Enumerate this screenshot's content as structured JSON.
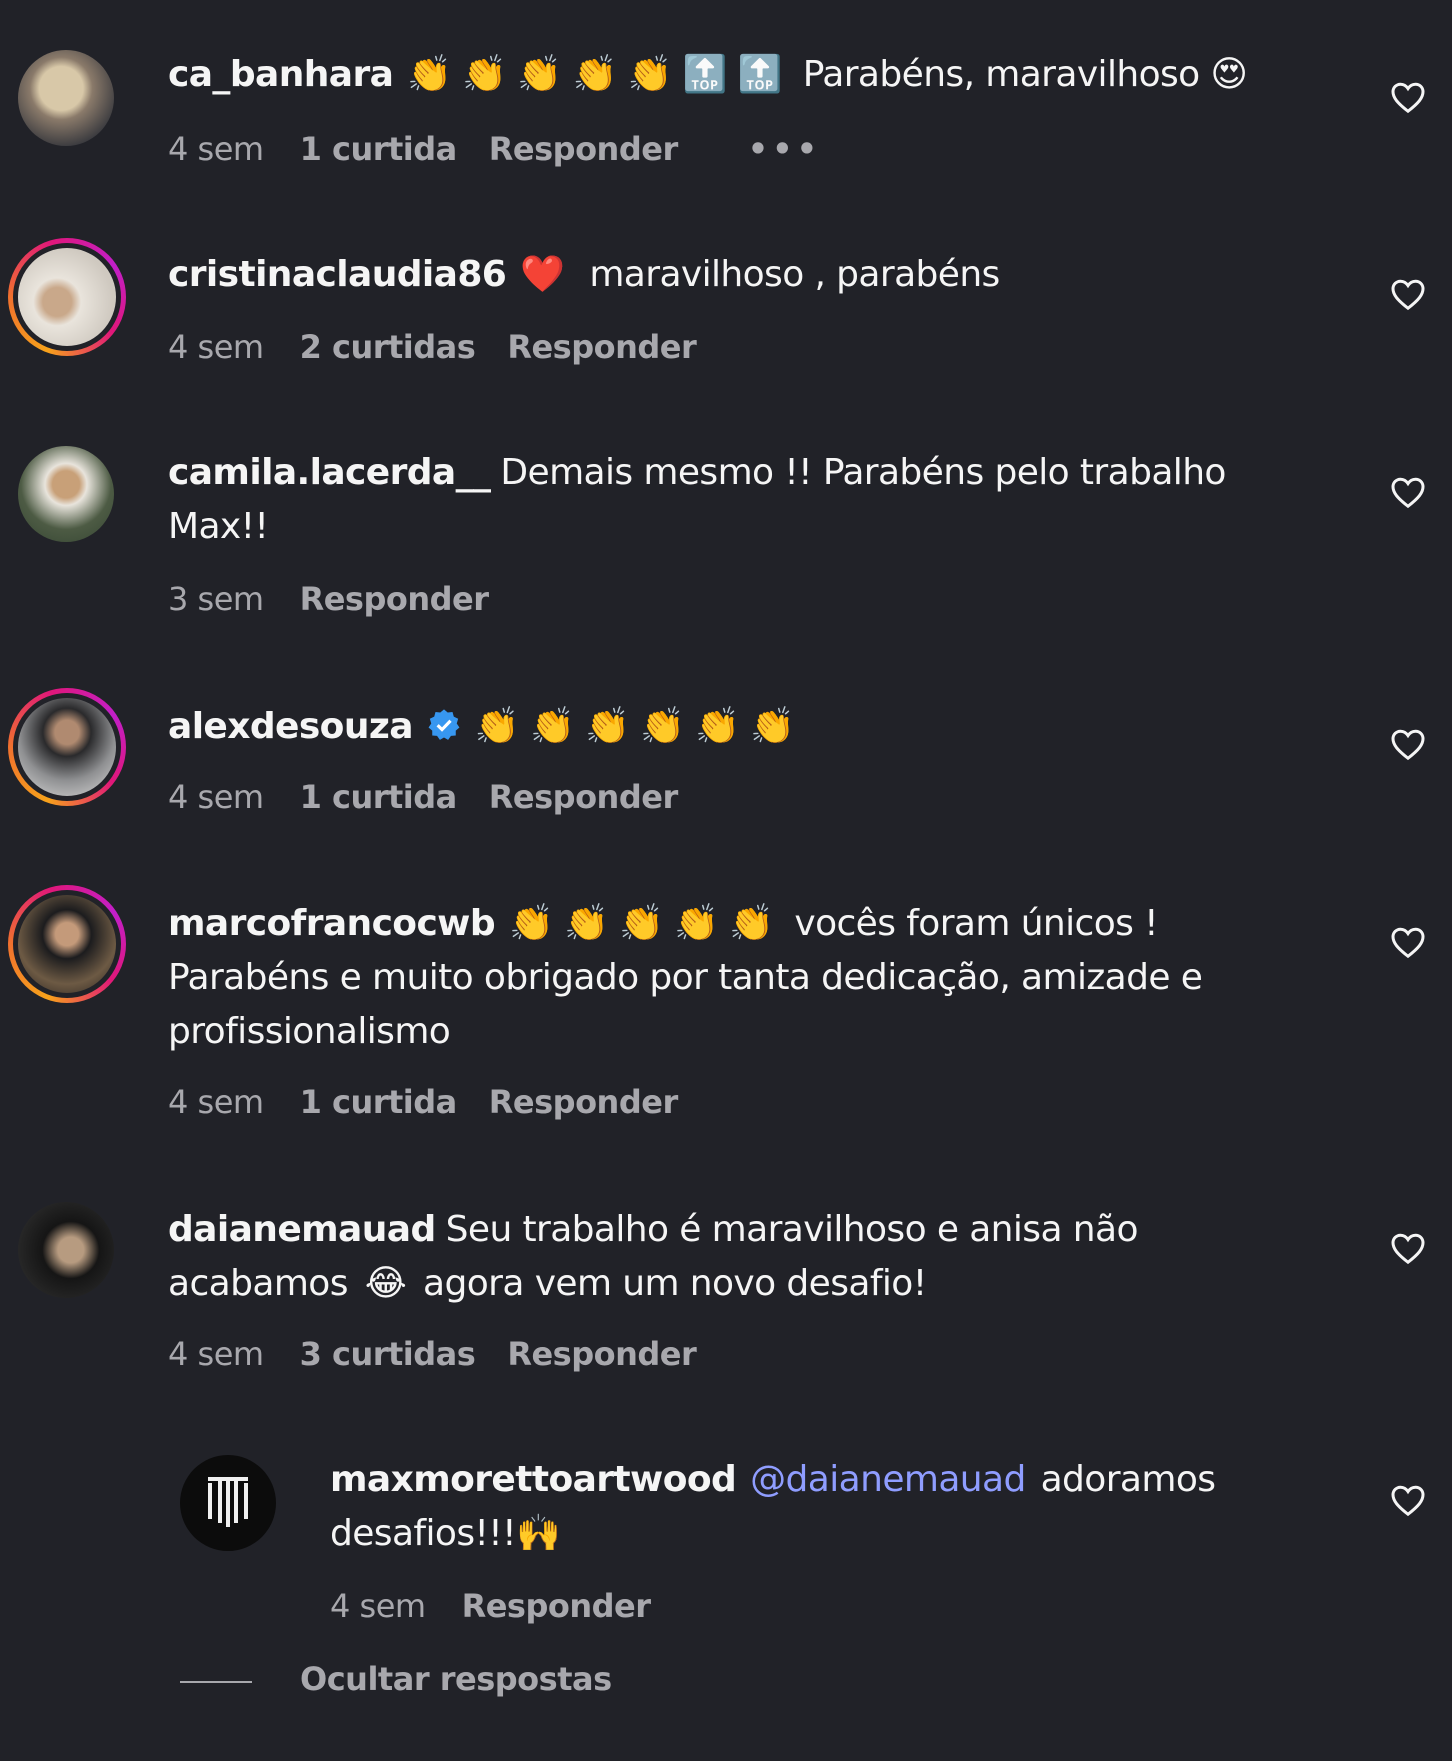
{
  "comments": [
    {
      "username": "ca_banhara",
      "emojis": "👏 👏 👏 👏 👏 🔝 🔝",
      "text": "Parabéns, maravilhoso",
      "trail_emoji": "😍",
      "time": "4 sem",
      "likes": "1 curtida",
      "reply": "Responder",
      "more": "•••"
    },
    {
      "username": "cristinaclaudia86",
      "emojis": "❤️",
      "text": "maravilhoso , parabéns",
      "time": "4 sem",
      "likes": "2 curtidas",
      "reply": "Responder"
    },
    {
      "username": "camila.lacerda__",
      "text": "Demais mesmo !! Parabéns pelo trabalho Max!!",
      "time": "3 sem",
      "reply": "Responder"
    },
    {
      "username": "alexdesouza",
      "emojis": "👏 👏 👏 👏 👏 👏",
      "time": "4 sem",
      "likes": "1 curtida",
      "reply": "Responder"
    },
    {
      "username": "marcofrancocwb",
      "emojis": "👏 👏 👏 👏 👏",
      "text": "vocês foram únicos ! Parabéns e muito obrigado por tanta dedicação, amizade e profissionalismo",
      "time": "4 sem",
      "likes": "1 curtida",
      "reply": "Responder"
    },
    {
      "username": "daianemauad",
      "text_a": "Seu trabalho é maravilhoso e anisa não acabamos",
      "mid_emoji": "😂",
      "text_b": "agora vem um novo desafio!",
      "time": "4 sem",
      "likes": "3 curtidas",
      "reply": "Responder"
    }
  ],
  "reply_item": {
    "username": "maxmorettoartwood",
    "mention": "@daianemauad",
    "text": "adoramos desafios!!!",
    "trail_emoji": "🙌",
    "time": "4 sem",
    "reply": "Responder"
  },
  "hide_replies": "Ocultar respostas",
  "colors": {
    "background": "#212228",
    "mention": "#8f9dff",
    "meta": "#a8a8ad",
    "verified": "#3797f0"
  }
}
